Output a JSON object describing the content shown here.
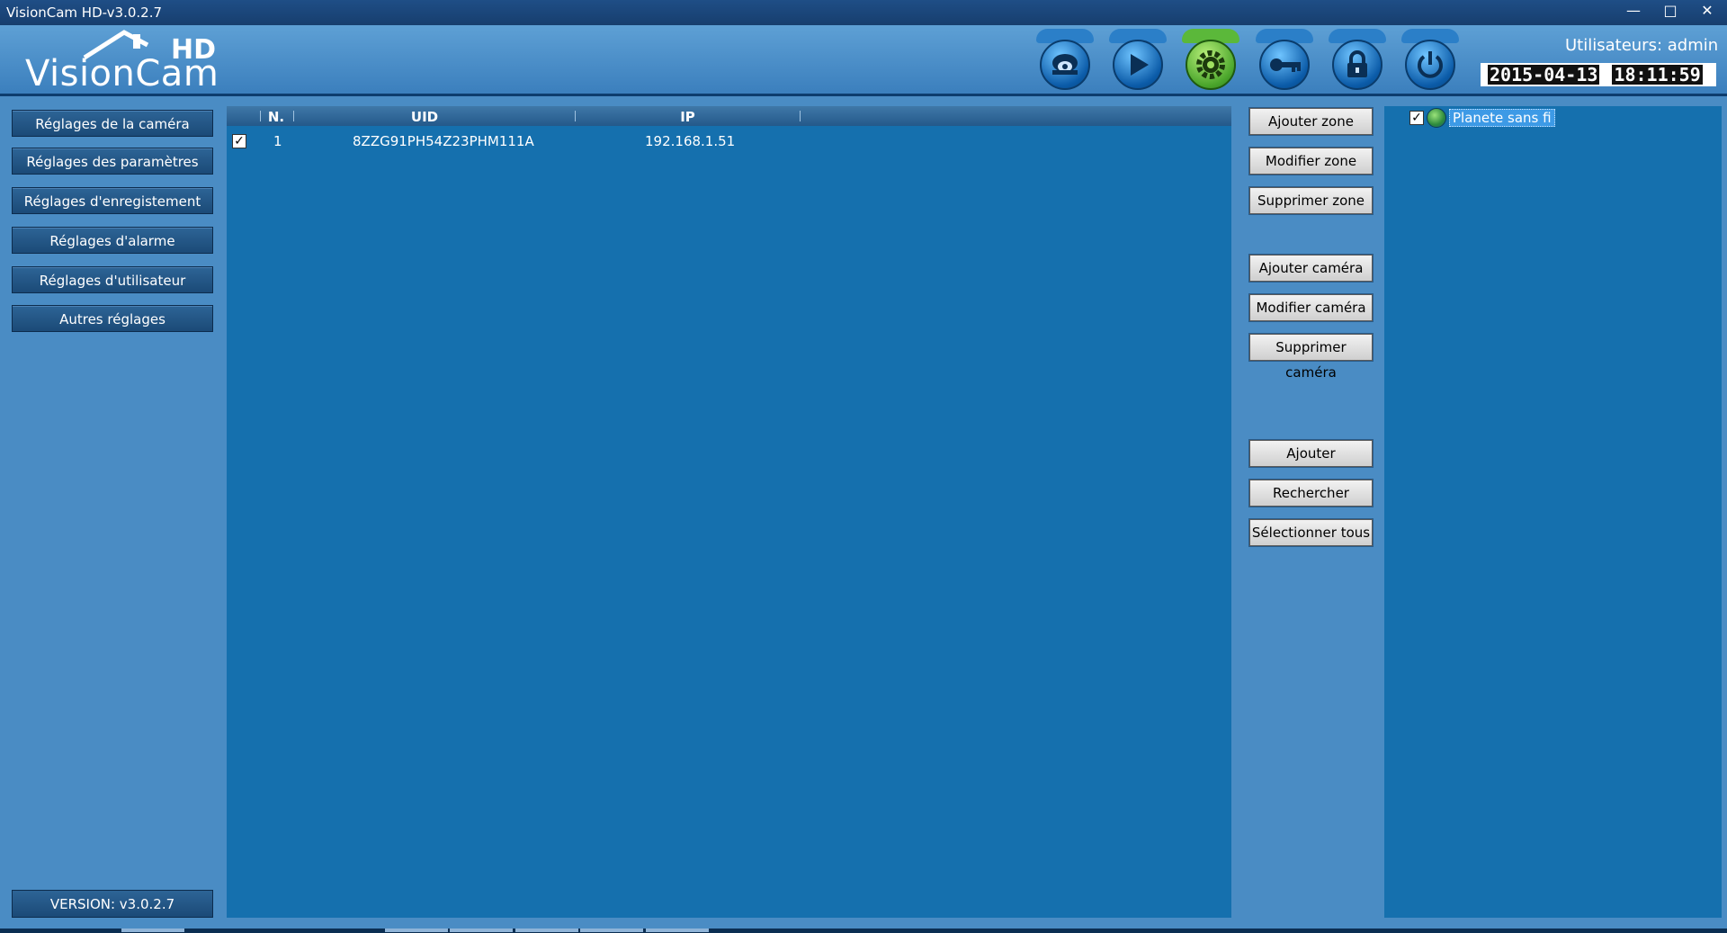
{
  "window": {
    "title": "VisionCam HD-v3.0.2.7",
    "minimize_icon": "minimize-icon",
    "maximize_icon": "maximize-icon",
    "close_icon": "close-icon"
  },
  "header": {
    "logo_text": "VisionCam",
    "logo_hd": "HD",
    "users_label": "Utilisateurs: admin",
    "date": "2015-04-13",
    "time": "18:11:59",
    "icons": [
      {
        "name": "camera-view-icon",
        "active": false
      },
      {
        "name": "playback-icon",
        "active": false
      },
      {
        "name": "settings-gear-icon",
        "active": true
      },
      {
        "name": "key-icon",
        "active": false
      },
      {
        "name": "lock-icon",
        "active": false
      },
      {
        "name": "power-icon",
        "active": false
      }
    ],
    "active_color": "#5bb83a",
    "icon_color": "#2b7fc8"
  },
  "sidebar": {
    "items": [
      {
        "label": "Réglages de la caméra"
      },
      {
        "label": "Réglages des paramètres"
      },
      {
        "label": "Réglages d'enregistement"
      },
      {
        "label": "Réglages d'alarme"
      },
      {
        "label": "Réglages d'utilisateur"
      },
      {
        "label": "Autres réglages"
      }
    ],
    "version": "VERSION: v3.0.2.7"
  },
  "table": {
    "headers": {
      "num": "N.",
      "uid": "UID",
      "ip": "IP"
    },
    "rows": [
      {
        "checked": true,
        "num": "1",
        "uid": "8ZZG91PH54Z23PHM111A",
        "ip": "192.168.1.51"
      }
    ]
  },
  "actions": {
    "add_zone": "Ajouter zone",
    "edit_zone": "Modifier zone",
    "delete_zone": "Supprimer zone",
    "add_camera": "Ajouter caméra",
    "edit_camera": "Modifier caméra",
    "delete_camera": "Supprimer caméra",
    "add": "Ajouter",
    "search": "Rechercher",
    "select_all": "Sélectionner tous"
  },
  "tree": {
    "item_label": "Planete sans fi",
    "checked": true
  }
}
